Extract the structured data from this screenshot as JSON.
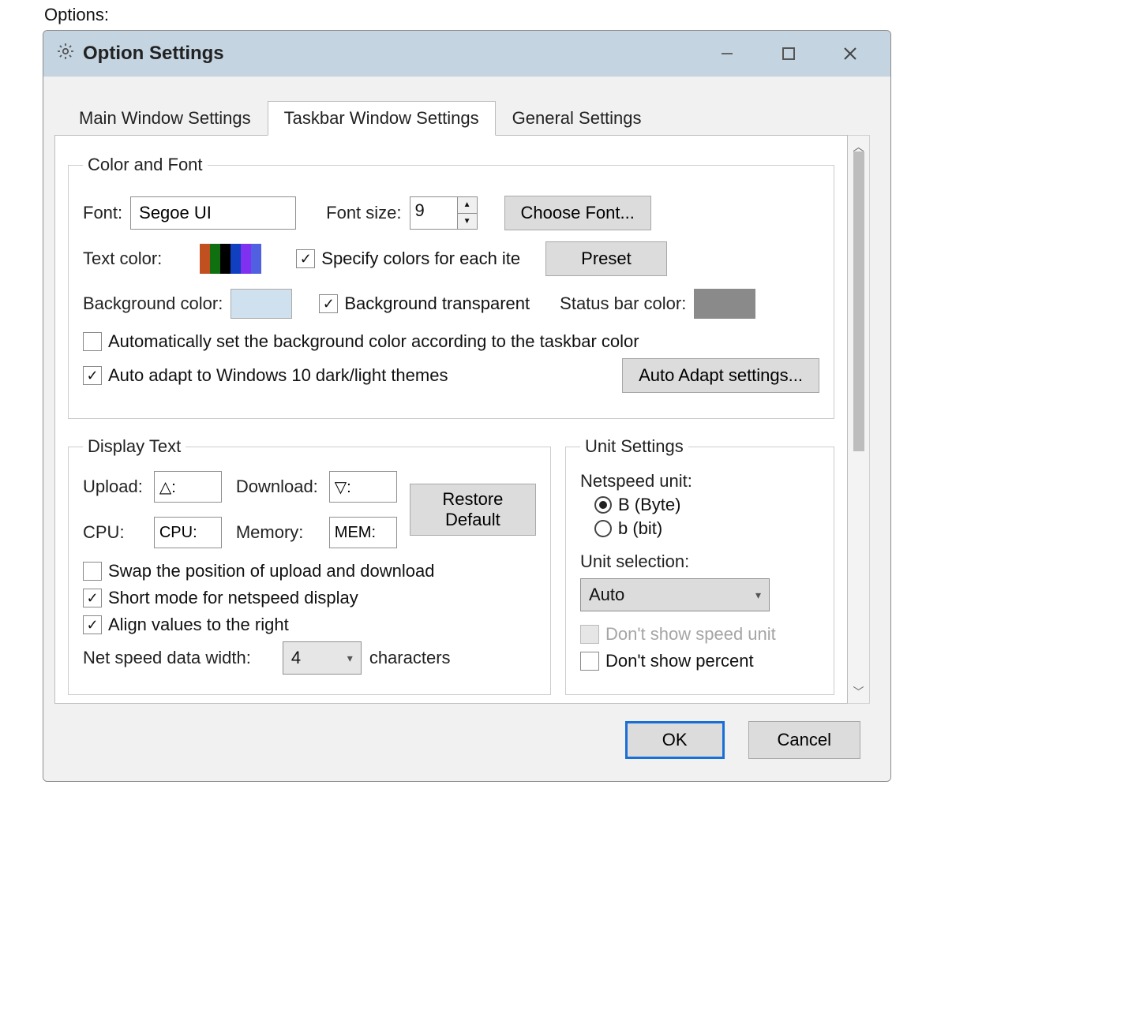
{
  "page_label": "Options:",
  "window": {
    "title": "Option Settings"
  },
  "tabs": {
    "main": "Main Window Settings",
    "taskbar": "Taskbar Window Settings",
    "general": "General Settings"
  },
  "color_font": {
    "legend": "Color and Font",
    "font_label": "Font:",
    "font_value": "Segoe UI",
    "font_size_label": "Font size:",
    "font_size_value": "9",
    "choose_font_btn": "Choose Font...",
    "text_color_label": "Text color:",
    "strip_colors": [
      "#c05020",
      "#107010",
      "#000000",
      "#1040c0",
      "#8030f0",
      "#5060e0"
    ],
    "specify_each_label": "Specify colors for each ite",
    "specify_each_checked": true,
    "preset_btn": "Preset",
    "bg_color_label": "Background color:",
    "bg_swatch": "#cfe1ef",
    "bg_transparent_label": "Background transparent",
    "bg_transparent_checked": true,
    "status_bar_label": "Status bar color:",
    "status_swatch": "#8a8a8a",
    "auto_bg_label": "Automatically set the background color according to the taskbar color",
    "auto_bg_checked": false,
    "auto_adapt_label": "Auto adapt to Windows 10 dark/light themes",
    "auto_adapt_checked": true,
    "auto_adapt_btn": "Auto Adapt settings..."
  },
  "display_text": {
    "legend": "Display Text",
    "upload_label": "Upload:",
    "upload_value": "△:",
    "download_label": "Download:",
    "download_value": "▽:",
    "cpu_label": "CPU:",
    "cpu_value": "CPU:",
    "memory_label": "Memory:",
    "memory_value": "MEM:",
    "restore_btn": "Restore Default",
    "swap_label": "Swap the position of upload and download",
    "swap_checked": false,
    "short_mode_label": "Short mode for netspeed display",
    "short_mode_checked": true,
    "align_right_label": "Align values to the right",
    "align_right_checked": true,
    "width_label": "Net speed data width:",
    "width_value": "4",
    "width_suffix": "characters"
  },
  "unit_settings": {
    "legend": "Unit Settings",
    "netspeed_unit_label": "Netspeed unit:",
    "byte_label": "B (Byte)",
    "bit_label": "b (bit)",
    "selected_unit": "byte",
    "unit_selection_label": "Unit selection:",
    "unit_selection_value": "Auto",
    "dont_show_speed_label": "Don't show speed unit",
    "dont_show_speed_checked": false,
    "dont_show_percent_label": "Don't show percent",
    "dont_show_percent_checked": false
  },
  "footer": {
    "ok": "OK",
    "cancel": "Cancel"
  }
}
